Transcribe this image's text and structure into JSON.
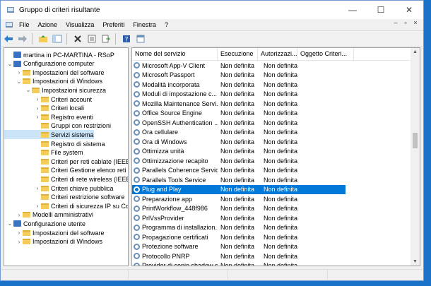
{
  "window": {
    "title": "Gruppo di criteri risultante",
    "caption": {
      "minimize": "—",
      "maximize": "☐",
      "close": "✕"
    }
  },
  "menu": [
    "File",
    "Azione",
    "Visualizza",
    "Preferiti",
    "Finestra",
    "?"
  ],
  "mdi_controls": {
    "minimize": "–",
    "restore": "▫",
    "close": "×"
  },
  "toolbar_icons": [
    "back-arrow-icon",
    "forward-arrow-icon",
    "up-folder-icon",
    "show-hide-tree-icon",
    "delete-icon",
    "properties-icon",
    "export-list-icon",
    "help-icon",
    "console-window-icon"
  ],
  "tree": [
    {
      "label": "martina in PC-MARTINA - RSoP",
      "level": 0,
      "exp": "",
      "icon": "pc"
    },
    {
      "label": "Configurazione computer",
      "level": 0,
      "exp": "⌄",
      "icon": "pc"
    },
    {
      "label": "Impostazioni del software",
      "level": 1,
      "exp": "›",
      "icon": "folder"
    },
    {
      "label": "Impostazioni di Windows",
      "level": 1,
      "exp": "⌄",
      "icon": "folder"
    },
    {
      "label": "Impostazioni sicurezza",
      "level": 2,
      "exp": "⌄",
      "icon": "folder"
    },
    {
      "label": "Criteri account",
      "level": 3,
      "exp": "›",
      "icon": "folder"
    },
    {
      "label": "Criteri locali",
      "level": 3,
      "exp": "›",
      "icon": "folder"
    },
    {
      "label": "Registro eventi",
      "level": 3,
      "exp": "›",
      "icon": "folder"
    },
    {
      "label": "Gruppi con restrizioni",
      "level": 3,
      "exp": "",
      "icon": "folder"
    },
    {
      "label": "Servizi sistema",
      "level": 3,
      "exp": "",
      "icon": "folder",
      "selected": true
    },
    {
      "label": "Registro di sistema",
      "level": 3,
      "exp": "",
      "icon": "folder"
    },
    {
      "label": "File system",
      "level": 3,
      "exp": "",
      "icon": "folder"
    },
    {
      "label": "Criteri per reti cablate (IEEE",
      "level": 3,
      "exp": "",
      "icon": "folder"
    },
    {
      "label": "Criteri Gestione elenco reti",
      "level": 3,
      "exp": "",
      "icon": "folder"
    },
    {
      "label": "Criteri di rete wireless (IEEE",
      "level": 3,
      "exp": "",
      "icon": "folder"
    },
    {
      "label": "Criteri chiave pubblica",
      "level": 3,
      "exp": "›",
      "icon": "folder"
    },
    {
      "label": "Criteri restrizione software",
      "level": 3,
      "exp": "",
      "icon": "folder"
    },
    {
      "label": "Criteri di sicurezza IP su Co",
      "level": 3,
      "exp": "›",
      "icon": "folder"
    },
    {
      "label": "Modelli amministrativi",
      "level": 1,
      "exp": "›",
      "icon": "folder"
    },
    {
      "label": "Configurazione utente",
      "level": 0,
      "exp": "⌄",
      "icon": "pc"
    },
    {
      "label": "Impostazioni del software",
      "level": 1,
      "exp": "›",
      "icon": "folder"
    },
    {
      "label": "Impostazioni di Windows",
      "level": 1,
      "exp": "›",
      "icon": "folder"
    }
  ],
  "columns": [
    "Nome del servizio",
    "Esecuzione ...",
    "Autorizzazi...",
    "Oggetto Criteri..."
  ],
  "rows": [
    {
      "name": "Microsoft App-V Client",
      "exec": "Non definita",
      "auth": "Non definita"
    },
    {
      "name": "Microsoft Passport",
      "exec": "Non definita",
      "auth": "Non definita"
    },
    {
      "name": "Modalità incorporata",
      "exec": "Non definita",
      "auth": "Non definita"
    },
    {
      "name": "Moduli di impostazione c...",
      "exec": "Non definita",
      "auth": "Non definita"
    },
    {
      "name": "Mozilla Maintenance Servi...",
      "exec": "Non definita",
      "auth": "Non definita"
    },
    {
      "name": "Office Source Engine",
      "exec": "Non definita",
      "auth": "Non definita"
    },
    {
      "name": "OpenSSH Authentication ...",
      "exec": "Non definita",
      "auth": "Non definita"
    },
    {
      "name": "Ora cellulare",
      "exec": "Non definita",
      "auth": "Non definita"
    },
    {
      "name": "Ora di Windows",
      "exec": "Non definita",
      "auth": "Non definita"
    },
    {
      "name": "Ottimizza unità",
      "exec": "Non definita",
      "auth": "Non definita"
    },
    {
      "name": "Ottimizzazione recapito",
      "exec": "Non definita",
      "auth": "Non definita"
    },
    {
      "name": "Parallels Coherence Service",
      "exec": "Non definita",
      "auth": "Non definita"
    },
    {
      "name": "Parallels Tools Service",
      "exec": "Non definita",
      "auth": "Non definita"
    },
    {
      "name": "Plug and Play",
      "exec": "Non definita",
      "auth": "Non definita",
      "selected": true
    },
    {
      "name": "Preparazione app",
      "exec": "Non definita",
      "auth": "Non definita"
    },
    {
      "name": "PrintWorkflow_448f986",
      "exec": "Non definita",
      "auth": "Non definita"
    },
    {
      "name": "PrlVssProvider",
      "exec": "Non definita",
      "auth": "Non definita"
    },
    {
      "name": "Programma di installazion...",
      "exec": "Non definita",
      "auth": "Non definita"
    },
    {
      "name": "Propagazione certificati",
      "exec": "Non definita",
      "auth": "Non definita"
    },
    {
      "name": "Protezione software",
      "exec": "Non definita",
      "auth": "Non definita"
    },
    {
      "name": "Protocollo PNRP",
      "exec": "Non definita",
      "auth": "Non definita"
    },
    {
      "name": "Provider di copie shadow s...",
      "exec": "Non definita",
      "auth": "Non definita"
    }
  ],
  "colors": {
    "selection": "#0078d7",
    "tree_selection": "#cce4f7",
    "desktop": "#1a73c9"
  }
}
